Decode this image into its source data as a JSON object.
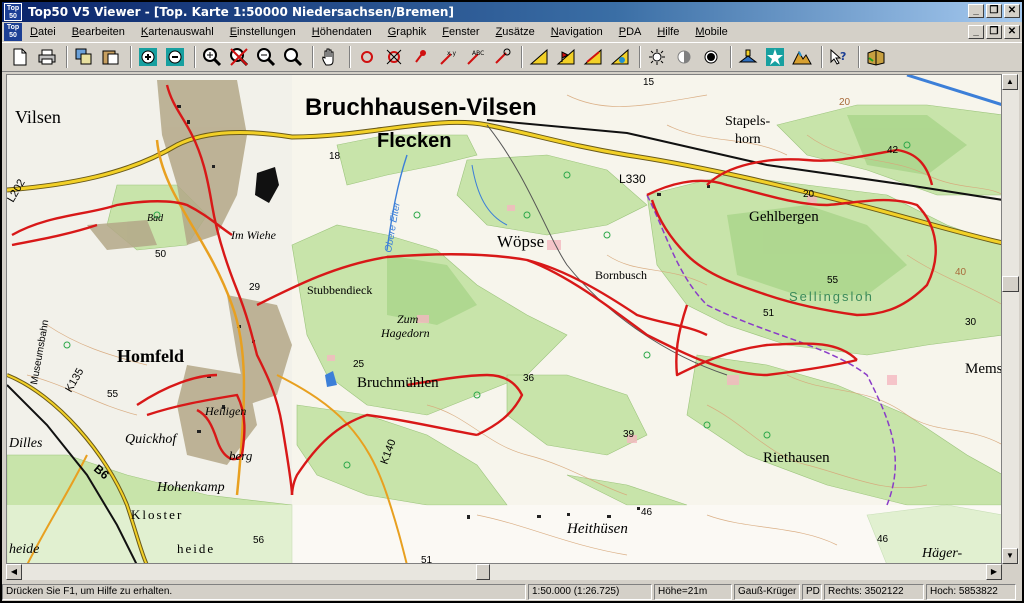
{
  "window": {
    "icon_text": "Top 50",
    "title": "Top50 V5 Viewer - [Top. Karte 1:50000 Niedersachsen/Bremen]",
    "controls": {
      "minimize": "_",
      "restore": "❐",
      "close": "✕"
    }
  },
  "menu": {
    "items": [
      "Datei",
      "Bearbeiten",
      "Kartenauswahl",
      "Einstellungen",
      "Höhendaten",
      "Graphik",
      "Fenster",
      "Zusätze",
      "Navigation",
      "PDA",
      "Hilfe",
      "Mobile"
    ]
  },
  "toolbar": {
    "icons": [
      "new-icon",
      "print-icon",
      "copy-map-icon",
      "paste-map-icon",
      "zoom-plus-icon",
      "zoom-minus-icon",
      "zoom-in-icon",
      "zoom-cross-icon",
      "zoom-out-icon",
      "zoom-fit-icon",
      "hand-pan-icon",
      "circle-icon",
      "circle-cross-icon",
      "pin-icon",
      "measure-icon",
      "measure-abc-icon",
      "triangle-icon",
      "triangle-flag-icon",
      "triangle-ruler-icon",
      "triangle-angle-icon",
      "brightness-icon",
      "contrast-icon",
      "dot-icon",
      "gps-icon",
      "star-icon",
      "mountain-icon",
      "help-pointer-icon",
      "book-icon"
    ]
  },
  "map": {
    "labels": {
      "town_main": "Bruchhausen-Vilsen",
      "town_sub": "Flecken",
      "vilsen": "Vilsen",
      "stapelshorn_1": "Stapels-",
      "stapelshorn_2": "horn",
      "gehlbergen": "Gehlbergen",
      "woepse": "Wöpse",
      "bornbusch": "Bornbusch",
      "stubbendieck": "Stubbendieck",
      "zum": "Zum",
      "hagedorn": "Hagedorn",
      "homfeld": "Homfeld",
      "bruchmuehlen": "Bruchmühlen",
      "heiligen": "Heiligen",
      "quickhof": "Quickhof",
      "berg": "berg",
      "hohenkamp": "Hohenkamp",
      "kloster": "Kloster",
      "heide_1": "heide",
      "heide_2": "heide",
      "heithuesen": "Heithüsen",
      "riethausen": "Riethausen",
      "haeger": "Häger-",
      "mems": "Mems",
      "sellingsloh": "Sellingsloh",
      "obere_eiter": "Obere Eiter",
      "im_wiehe": "Im Wiehe",
      "bad": "Bad",
      "museumsbahn": "Museumsbahn",
      "dilles": "Dilles",
      "road_l202": "L202",
      "road_l330": "L330",
      "road_k135": "K135",
      "road_k140": "K140",
      "road_b6": "B6",
      "h15": "15",
      "h18": "18",
      "h20a": "20",
      "h20b": "20",
      "h29": "29",
      "h25": "25",
      "h36": "36",
      "h39": "39",
      "h42": "42",
      "h30": "30",
      "h40": "40",
      "h46a": "46",
      "h46b": "46",
      "h50": "50",
      "h51a": "51",
      "h51b": "51",
      "h55a": "55",
      "h55b": "55",
      "h56": "56"
    },
    "colors": {
      "forest": "#c6e3a8",
      "forest_dark": "#a9d48a",
      "urban": "#b4a888",
      "track": "#d81818",
      "road_main": "#f2d027",
      "water": "#3c7fd8",
      "contour": "#d7a77a"
    }
  },
  "statusbar": {
    "help": "Drücken Sie F1, um Hilfe zu erhalten.",
    "scale": "1:50.000  (1:26.725)",
    "height": "Höhe=21m",
    "projection": "Gauß-Krüger",
    "datum": "PD",
    "rechts": "Rechts: 3502122",
    "hoch": "Hoch: 5853822"
  }
}
